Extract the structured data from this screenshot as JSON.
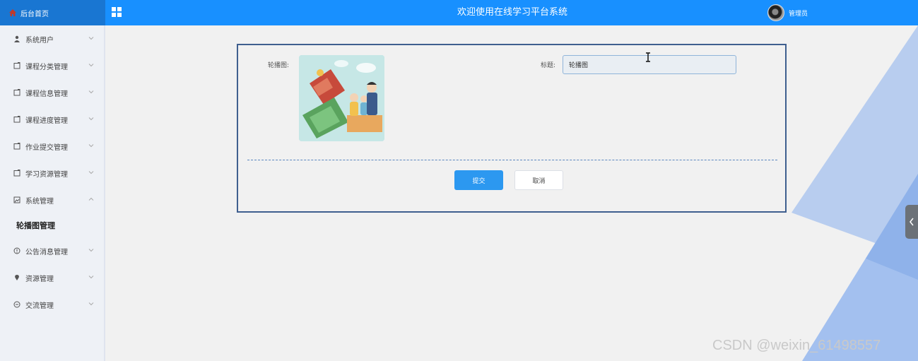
{
  "header": {
    "home_label": "后台首页",
    "title": "欢迎使用在线学习平台系统",
    "user_name": "管理员"
  },
  "sidebar": {
    "items": [
      {
        "label": "系统用户",
        "icon": "user-icon",
        "expanded": false
      },
      {
        "label": "课程分类管理",
        "icon": "doc-icon",
        "expanded": false
      },
      {
        "label": "课程信息管理",
        "icon": "doc-icon",
        "expanded": false
      },
      {
        "label": "课程进度管理",
        "icon": "doc-icon",
        "expanded": false
      },
      {
        "label": "作业提交管理",
        "icon": "doc-icon",
        "expanded": false
      },
      {
        "label": "学习资源管理",
        "icon": "doc-icon",
        "expanded": false
      },
      {
        "label": "系统管理",
        "icon": "image-icon",
        "expanded": true
      },
      {
        "label": "公告消息管理",
        "icon": "info-icon",
        "expanded": false
      },
      {
        "label": "资源管理",
        "icon": "location-icon",
        "expanded": false
      },
      {
        "label": "交流管理",
        "icon": "chat-icon",
        "expanded": false
      }
    ],
    "active_sub": "轮播图管理"
  },
  "form": {
    "image_label": "轮播图:",
    "title_label": "标题:",
    "title_value": "轮播图",
    "submit_label": "提交",
    "cancel_label": "取消"
  },
  "watermark": "CSDN @weixin_61498557",
  "colors": {
    "header": "#1890ff",
    "primary_button": "#2c98f0",
    "sidebar_bg": "#eef1f6",
    "panel_border": "#3f5f8f"
  }
}
